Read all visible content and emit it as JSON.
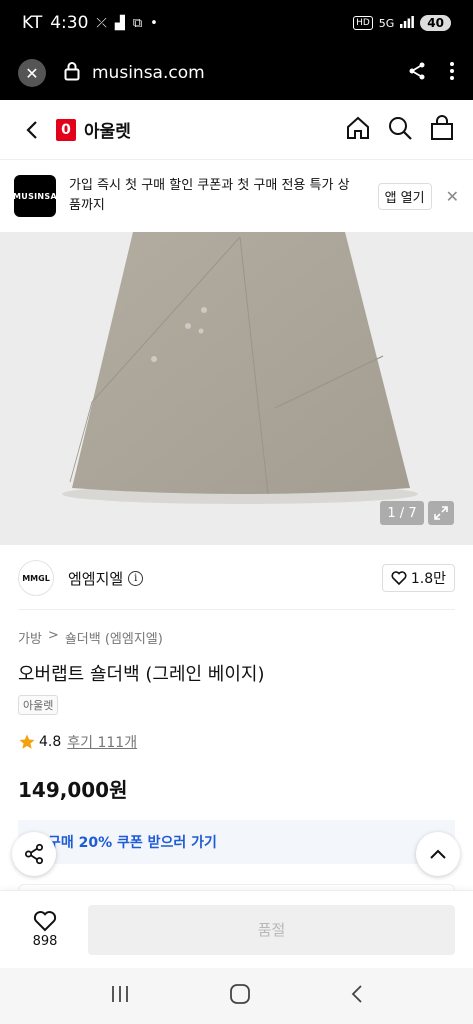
{
  "status_bar": {
    "carrier": "KT",
    "time": "4:30",
    "hd": "HD",
    "network": "5G",
    "battery": "40"
  },
  "browser": {
    "url": "musinsa.com"
  },
  "header": {
    "badge": "0",
    "title": "아울렛"
  },
  "promo": {
    "logo": "MUSINSA",
    "text": "가입 즉시 첫 구매 할인 쿠폰과 첫 구매 전용 특가 상품까지",
    "open_app": "앱 열기"
  },
  "gallery": {
    "counter": "1 / 7"
  },
  "brand": {
    "logo": "MMGL",
    "name": "엠엠지엘",
    "likes": "1.8만"
  },
  "breadcrumb": {
    "category": "가방",
    "sep": ">",
    "subcategory": "숄더백 (엠엠지엘)"
  },
  "product": {
    "title": "오버랩트 숄더백 (그레인 베이지)",
    "tag": "아울렛",
    "rating": "4.8",
    "reviews": "후기 111개",
    "price": "149,000원"
  },
  "coupon": {
    "text": "구매 20% 쿠폰 받으러 가기"
  },
  "actions": {
    "like_count": "898",
    "soldout": "품절"
  },
  "colors": {
    "accent_red": "#e3001b",
    "coupon_blue": "#1e5bd6",
    "star": "#f2a20c"
  }
}
